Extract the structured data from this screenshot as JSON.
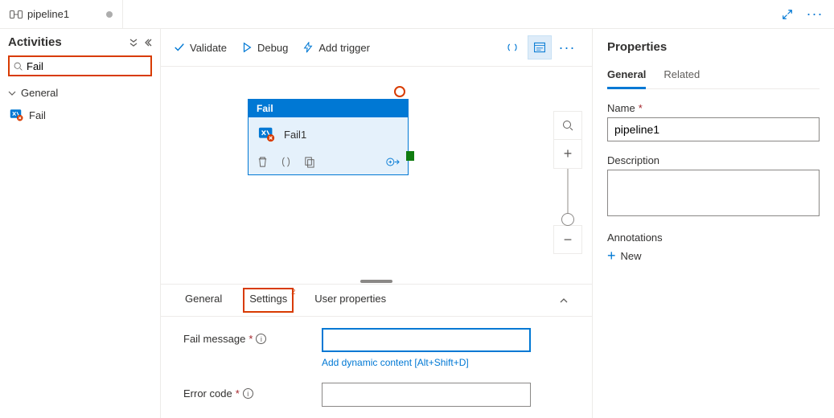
{
  "tab": {
    "icon": "pipeline-icon",
    "title": "pipeline1"
  },
  "activities": {
    "title": "Activities",
    "search_value": "Fail",
    "groups": [
      {
        "label": "General",
        "items": [
          {
            "label": "Fail"
          }
        ]
      }
    ]
  },
  "toolbar": {
    "validate": "Validate",
    "debug": "Debug",
    "add_trigger": "Add trigger"
  },
  "canvas": {
    "node": {
      "type_label": "Fail",
      "name": "Fail1"
    }
  },
  "bottom": {
    "tabs": {
      "general": "General",
      "settings": "Settings",
      "settings_badge": "2",
      "user_props": "User properties"
    },
    "fail_message_label": "Fail message",
    "fail_message_value": "",
    "dynamic_link": "Add dynamic content [Alt+Shift+D]",
    "error_code_label": "Error code",
    "error_code_value": ""
  },
  "props": {
    "title": "Properties",
    "tabs": {
      "general": "General",
      "related": "Related"
    },
    "name_label": "Name",
    "name_value": "pipeline1",
    "description_label": "Description",
    "description_value": "",
    "annotations_label": "Annotations",
    "new_label": "New"
  }
}
